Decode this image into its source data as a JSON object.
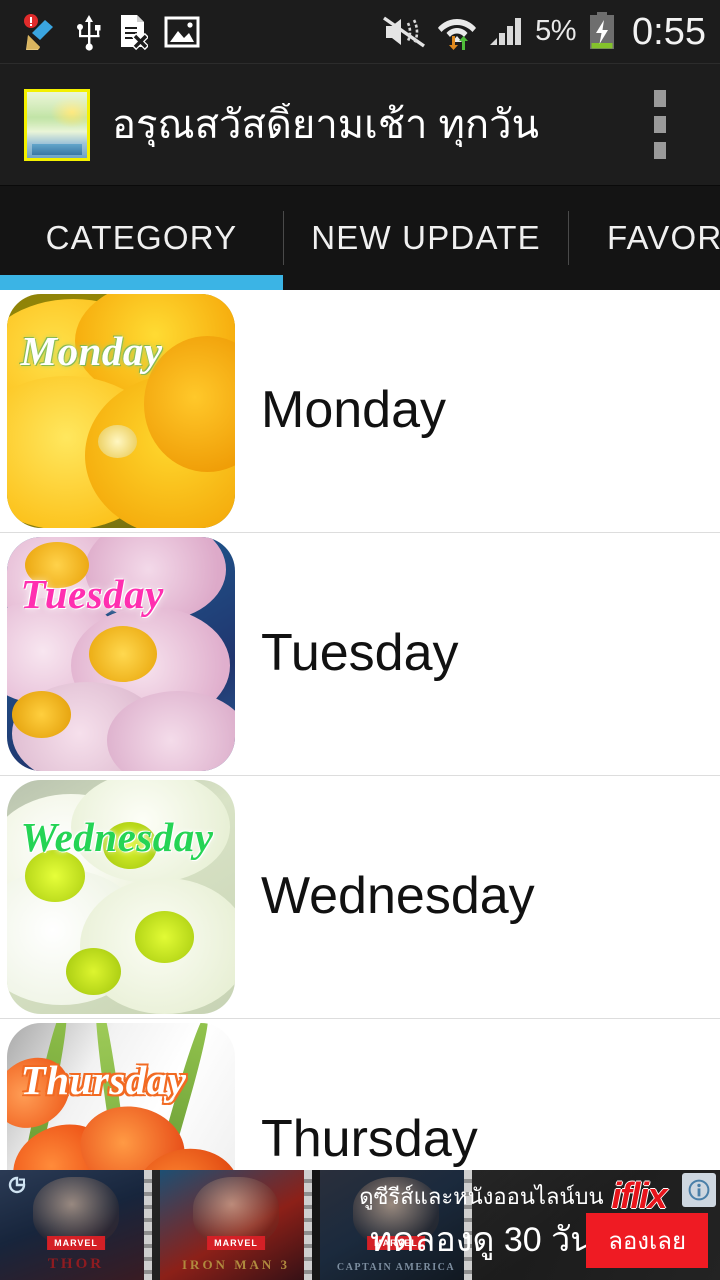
{
  "statusbar": {
    "left_icons": [
      {
        "name": "cleaner-broom-icon",
        "glyph": "broom"
      },
      {
        "name": "usb-icon",
        "glyph": "usb"
      },
      {
        "name": "document-error-icon",
        "glyph": "doc-x"
      },
      {
        "name": "image-icon",
        "glyph": "photo"
      }
    ],
    "right_icons": [
      {
        "name": "sound-mute-vibrate-icon",
        "glyph": "mute"
      },
      {
        "name": "wifi-data-icon",
        "glyph": "wifi"
      },
      {
        "name": "cellular-signal-icon",
        "glyph": "signal"
      }
    ],
    "battery_percent": "5%",
    "battery_state": "charging",
    "clock": "0:55"
  },
  "actionbar": {
    "app_title": "อรุณสวัสดิ์ยามเช้า ทุกวัน",
    "app_icon_name": "app-logo-flower",
    "overflow_label": "More options"
  },
  "tabs": {
    "items": [
      {
        "label": "CATEGORY",
        "active": true
      },
      {
        "label": "NEW UPDATE",
        "active": false
      },
      {
        "label": "FAVOR",
        "active": false
      }
    ],
    "indicator_color": "#3bb4e5"
  },
  "list": {
    "rows": [
      {
        "label": "Monday",
        "thumb_label": "Monday",
        "thumb_name": "thumbnail-monday"
      },
      {
        "label": "Tuesday",
        "thumb_label": "Tuesday",
        "thumb_name": "thumbnail-tuesday"
      },
      {
        "label": "Wednesday",
        "thumb_label": "Wednesday",
        "thumb_name": "thumbnail-wednesday"
      },
      {
        "label": "Thursday",
        "thumb_label": "Thursday",
        "thumb_name": "thumbnail-thursday"
      }
    ]
  },
  "ad": {
    "headline": "ดูซีรีส์และหนังออนไลน์บน",
    "brand": "iflix",
    "offer": "ทดลองดู 30 วัน",
    "cta": "ลองเลย",
    "posters": [
      {
        "title": "THOR",
        "badge": "MARVEL"
      },
      {
        "title": "IRON MAN 3",
        "badge": "MARVEL"
      },
      {
        "title": "CAPTAIN AMERICA",
        "badge": "MARVEL"
      }
    ],
    "info_label": "i",
    "cta_color": "#ef1b23",
    "brand_color": "#e8141b"
  }
}
